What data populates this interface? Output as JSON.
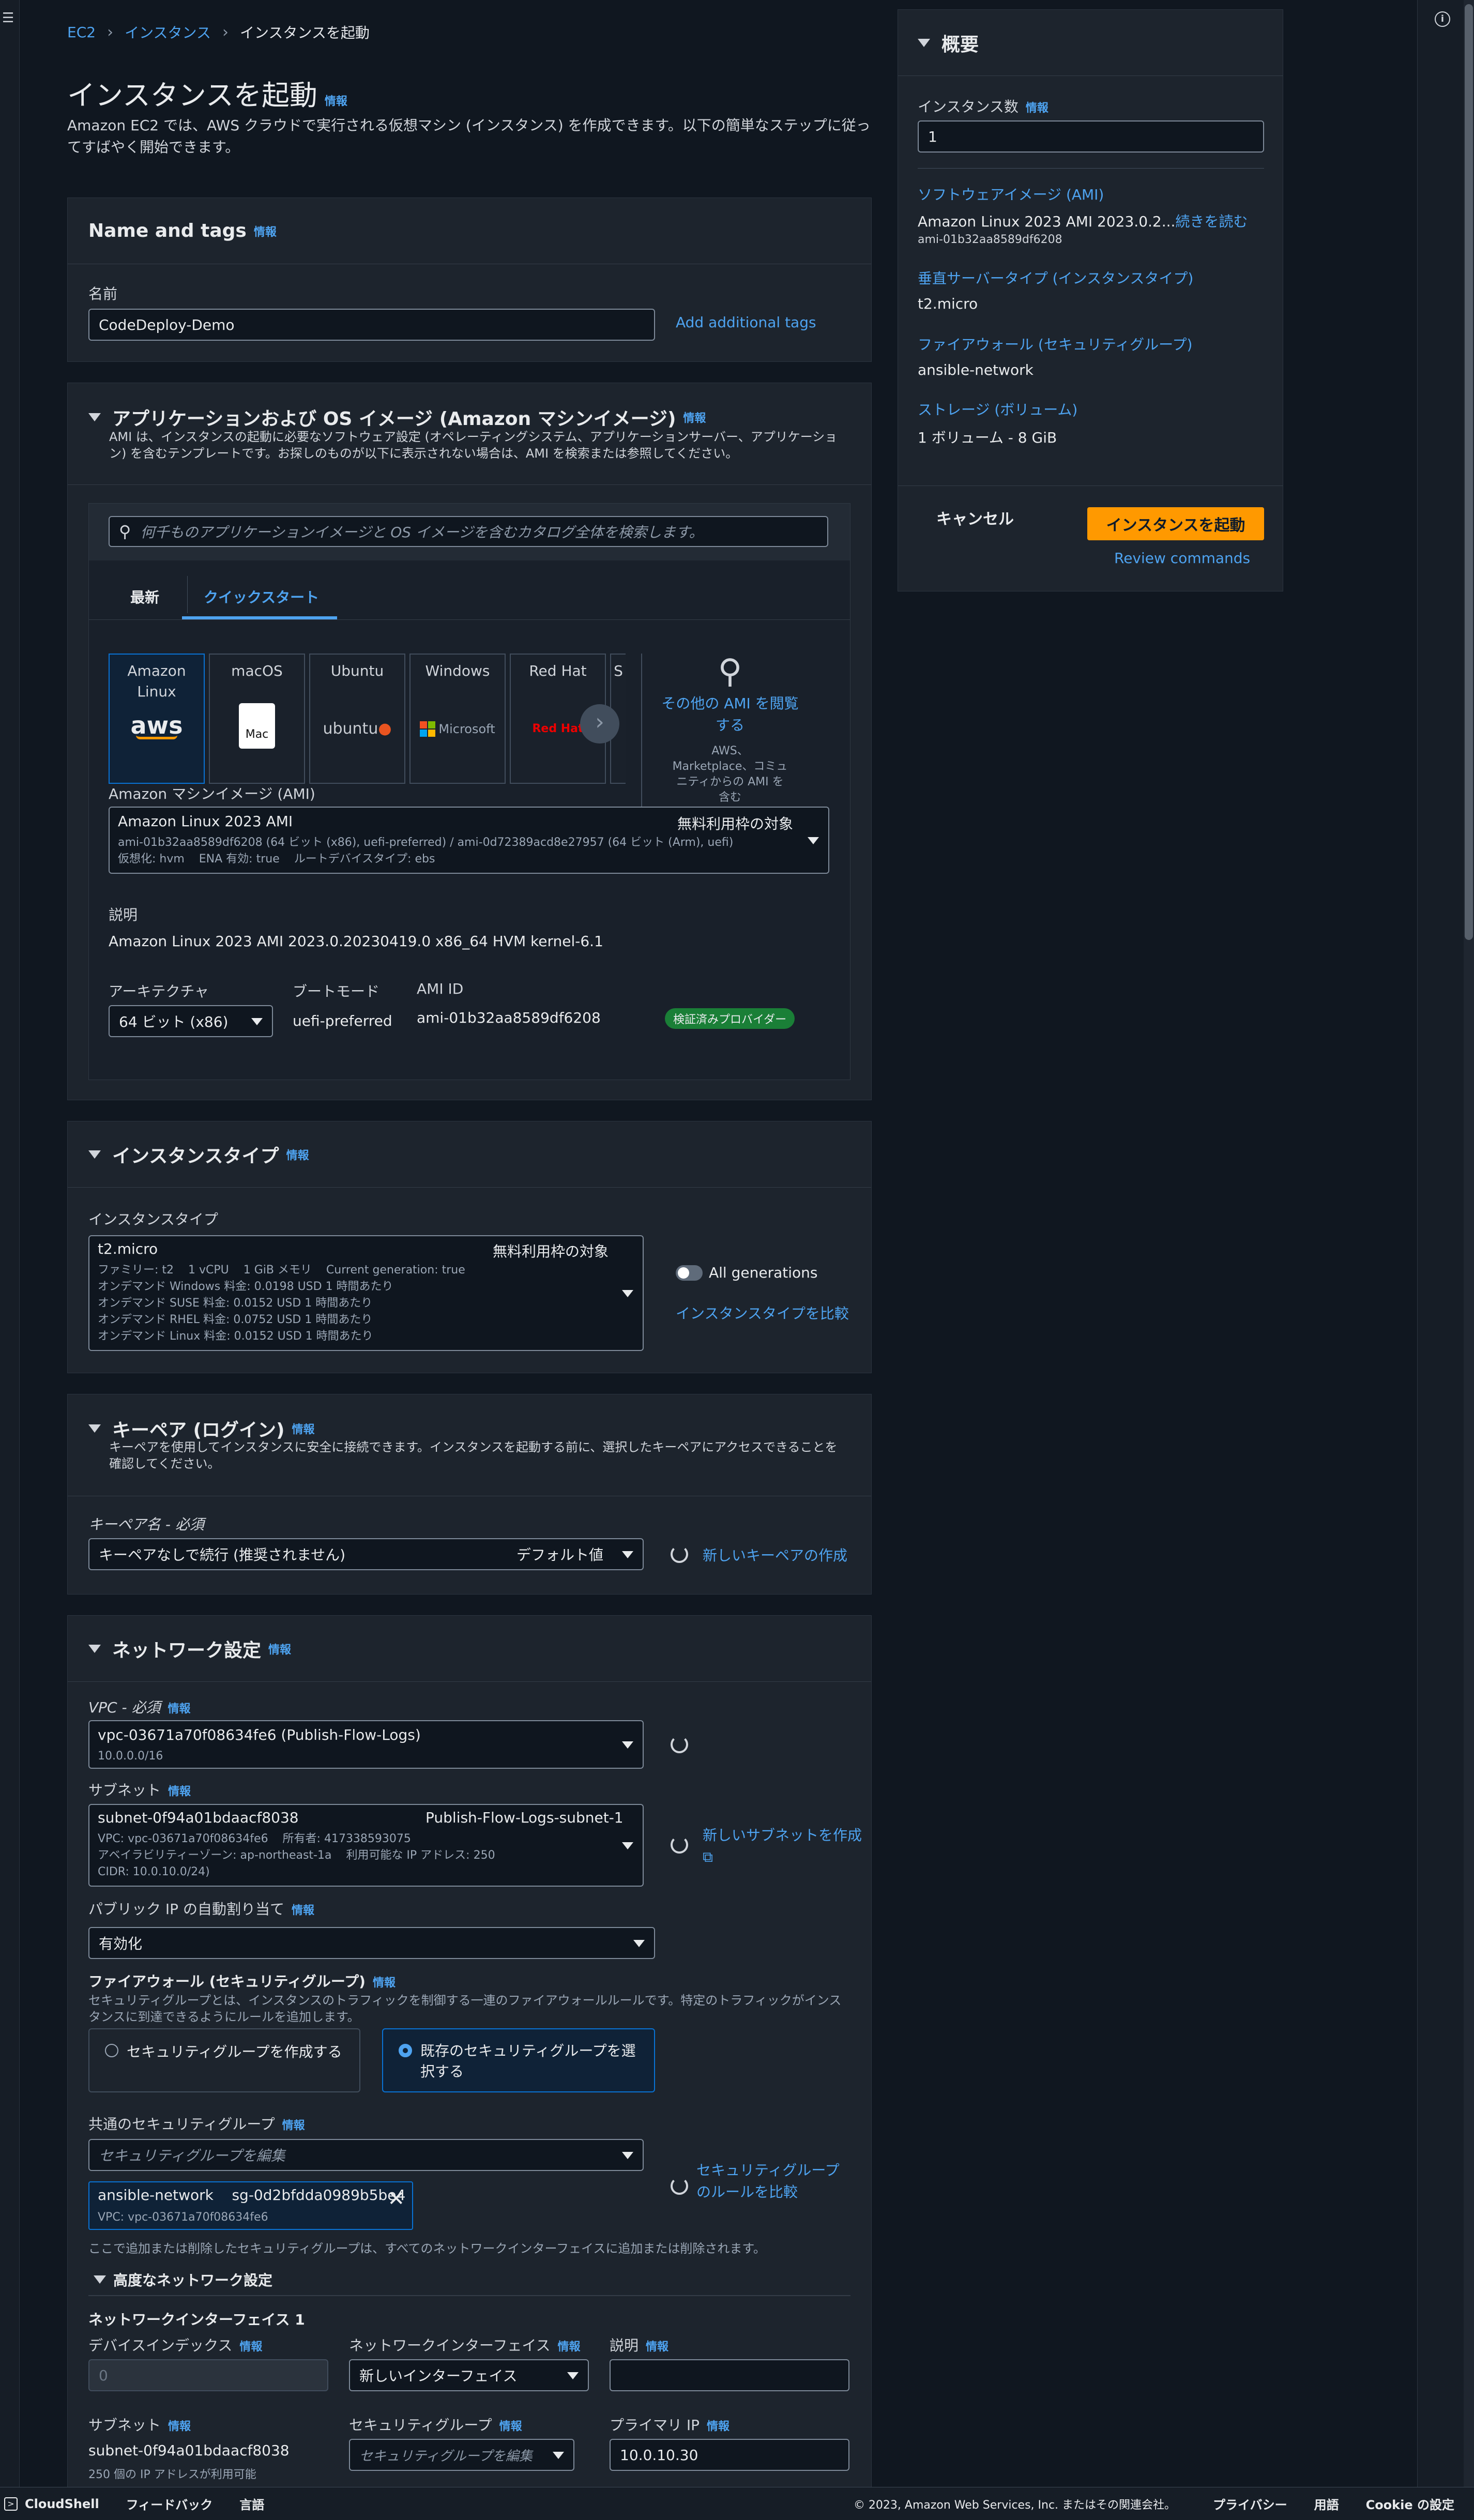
{
  "breadcrumb": {
    "items": [
      "EC2",
      "インスタンス",
      "インスタンスを起動"
    ]
  },
  "page": {
    "title": "インスタンスを起動",
    "info": "情報",
    "description": "Amazon EC2 では、AWS クラウドで実行される仮想マシン (インスタンス) を作成できます。以下の簡単なステップに従ってすばやく開始できます。"
  },
  "name_tags": {
    "title": "Name and tags",
    "info": "情報",
    "name_label": "名前",
    "name_value": "CodeDeploy-Demo",
    "add_tags": "Add additional tags"
  },
  "ami": {
    "title": "アプリケーションおよび OS イメージ (Amazon マシンイメージ)",
    "info": "情報",
    "desc": "AMI は、インスタンスの起動に必要なソフトウェア設定 (オペレーティングシステム、アプリケーションサーバー、アプリケーション) を含むテンプレートです。お探しのものが以下に表示されない場合は、AMI を検索または参照してください。",
    "search_placeholder": "何千ものアプリケーションイメージと OS イメージを含むカタログ全体を検索します。",
    "tabs": [
      "最新",
      "クイックスタート"
    ],
    "tiles": [
      {
        "label": "Amazon Linux",
        "logo": "aws"
      },
      {
        "label": "macOS",
        "logo": "Mac"
      },
      {
        "label": "Ubuntu",
        "logo": "ubuntu"
      },
      {
        "label": "Windows",
        "logo": "Microsoft"
      },
      {
        "label": "Red Hat",
        "logo": "Red Hat"
      },
      {
        "label": "S",
        "logo": ""
      }
    ],
    "more_ami_link": "その他の AMI を閲覧する",
    "more_ami_sub": "AWS、Marketplace、コミュニティからの AMI を含む",
    "ami_label": "Amazon マシンイメージ (AMI)",
    "selected_name": "Amazon Linux 2023 AMI",
    "free_tier": "無料利用枠の対象",
    "selected_line1": "ami-01b32aa8589df6208 (64 ビット (x86), uefi-preferred) / ami-0d72389acd8e27957 (64 ビット (Arm), uefi)",
    "selected_line2": "仮想化: hvm    ENA 有効: true    ルートデバイスタイプ: ebs",
    "desc_label": "説明",
    "desc_value": "Amazon Linux 2023 AMI 2023.0.20230419.0 x86_64 HVM kernel-6.1",
    "arch_label": "アーキテクチャ",
    "arch_value": "64 ビット (x86)",
    "boot_label": "ブートモード",
    "boot_value": "uefi-preferred",
    "amiid_label": "AMI ID",
    "amiid_value": "ami-01b32aa8589df6208",
    "verified": "検証済みプロバイダー"
  },
  "instance_type": {
    "title": "インスタンスタイプ",
    "info": "情報",
    "label": "インスタンスタイプ",
    "name": "t2.micro",
    "free_tier": "無料利用枠の対象",
    "lines": [
      "ファミリー: t2    1 vCPU    1 GiB メモリ    Current generation: true",
      "オンデマンド Windows 料金: 0.0198 USD 1 時間あたり",
      "オンデマンド SUSE 料金: 0.0152 USD 1 時間あたり",
      "オンデマンド RHEL 料金: 0.0752 USD 1 時間あたり",
      "オンデマンド Linux 料金: 0.0152 USD 1 時間あたり"
    ],
    "all_generations": "All generations",
    "compare": "インスタンスタイプを比較"
  },
  "keypair": {
    "title": "キーペア (ログイン)",
    "info": "情報",
    "desc": "キーペアを使用してインスタンスに安全に接続できます。インスタンスを起動する前に、選択したキーペアにアクセスできることを確認してください。",
    "label": "キーペア名 - 必須",
    "value": "キーペアなしで続行 (推奨されません)",
    "default": "デフォルト値",
    "create": "新しいキーペアの作成"
  },
  "network": {
    "title": "ネットワーク設定",
    "info": "情報",
    "vpc_label": "VPC - 必須",
    "vpc_value": "vpc-03671a70f08634fe6 (Publish-Flow-Logs)",
    "vpc_cidr": "10.0.0.0/16",
    "subnet_label": "サブネット",
    "subnet_id": "subnet-0f94a01bdaacf8038",
    "subnet_name": "Publish-Flow-Logs-subnet-1",
    "subnet_line1": "VPC: vpc-03671a70f08634fe6    所有者: 417338593075",
    "subnet_line2": "アベイラビリティーゾーン: ap-northeast-1a    利用可能な IP アドレス: 250",
    "subnet_line3": "CIDR: 10.0.10.0/24)",
    "new_subnet": "新しいサブネットを作成",
    "public_ip_label": "パブリック IP の自動割り当て",
    "public_ip_value": "有効化",
    "fw_label": "ファイアウォール (セキュリティグループ)",
    "fw_desc": "セキュリティグループとは、インスタンスのトラフィックを制御する一連のファイアウォールルールです。特定のトラフィックがインスタンスに到達できるようにルールを追加します。",
    "fw_create": "セキュリティグループを作成する",
    "fw_existing": "既存のセキュリティグループを選択する",
    "common_sg_label": "共通のセキュリティグループ",
    "common_sg_placeholder": "セキュリティグループを編集",
    "sg_token_name": "ansible-network    sg-0d2bfdda0989b5be4",
    "sg_token_vpc": "VPC: vpc-03671a70f08634fe6",
    "compare_sg": "セキュリティグループのルールを比較",
    "sg_note": "ここで追加または削除したセキュリティグループは、すべてのネットワークインターフェイスに追加または削除されます。",
    "advanced": "高度なネットワーク設定",
    "nic_title": "ネットワークインターフェイス 1",
    "device_index_label": "デバイスインデックス",
    "device_index_value": "0",
    "nic_label": "ネットワークインターフェイス",
    "nic_value": "新しいインターフェイス",
    "desc_label": "説明",
    "subnet2_label": "サブネット",
    "subnet2_value": "subnet-0f94a01bdaacf8038",
    "subnet2_sub": "250 個の IP アドレスが利用可能",
    "sg2_label": "セキュリティグループ",
    "sg2_placeholder": "セキュリティグループを編集",
    "primary_ip_label": "プライマリ IP",
    "primary_ip_value": "10.0.10.30"
  },
  "summary": {
    "title": "概要",
    "count_label": "インスタンス数",
    "count_value": "1",
    "ami_link": "ソフトウェアイメージ (AMI)",
    "ami_value": "Amazon Linux 2023 AMI 2023.0.2...",
    "read_more": "続きを読む",
    "ami_id": "ami-01b32aa8589df6208",
    "type_link": "垂直サーバータイプ (インスタンスタイプ)",
    "type_value": "t2.micro",
    "fw_link": "ファイアウォール (セキュリティグループ)",
    "fw_value": "ansible-network",
    "storage_link": "ストレージ (ボリューム)",
    "storage_value": "1 ボリューム - 8 GiB",
    "cancel": "キャンセル",
    "launch": "インスタンスを起動",
    "review": "Review commands",
    "info": "情報"
  },
  "footer": {
    "cloudshell": "CloudShell",
    "feedback": "フィードバック",
    "language": "言語",
    "copyright": "© 2023, Amazon Web Services, Inc. またはその関連会社。",
    "privacy": "プライバシー",
    "terms": "用語",
    "cookie": "Cookie の設定"
  }
}
